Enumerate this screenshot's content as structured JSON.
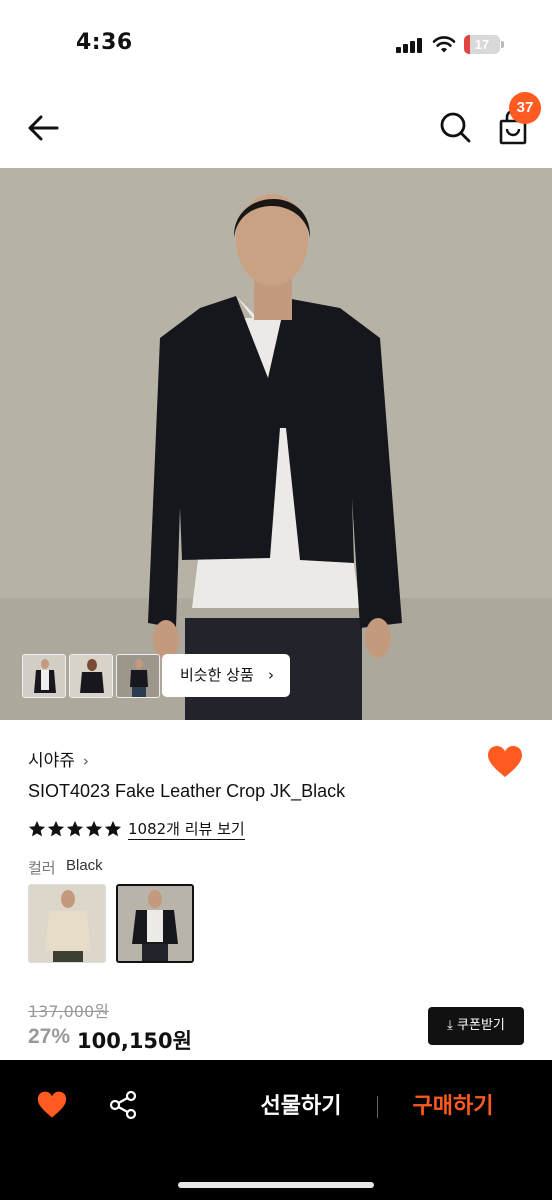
{
  "status_bar": {
    "time": "4:36",
    "battery": "17",
    "battery_level": 0.17
  },
  "header": {
    "cart_count": "37"
  },
  "gallery": {
    "similar_label": "비슷한 상품",
    "similar_chevron": "›"
  },
  "product": {
    "brand": "시야쥬",
    "brand_chevron": "›",
    "name": "SIOT4023 Fake Leather Crop JK_Black",
    "rating": 5,
    "review_link": "1082개 리뷰 보기",
    "color_label": "컬러",
    "color_value": "Black",
    "original_price": "137,000원",
    "discount": "27%",
    "sale_price": "100,150원",
    "coupon_label": "⤓ 쿠폰받기"
  },
  "bottom_bar": {
    "gift_label": "선물하기",
    "buy_label": "구매하기"
  },
  "colors": {
    "accent": "#ff5a1f",
    "text": "#111111",
    "muted": "#999999",
    "bar": "#000000"
  },
  "icons": {
    "back": "arrow-left-icon",
    "search": "search-icon",
    "cart": "shopping-bag-icon",
    "like": "heart-icon",
    "share": "share-icon",
    "star": "star-icon",
    "download": "download-icon"
  }
}
